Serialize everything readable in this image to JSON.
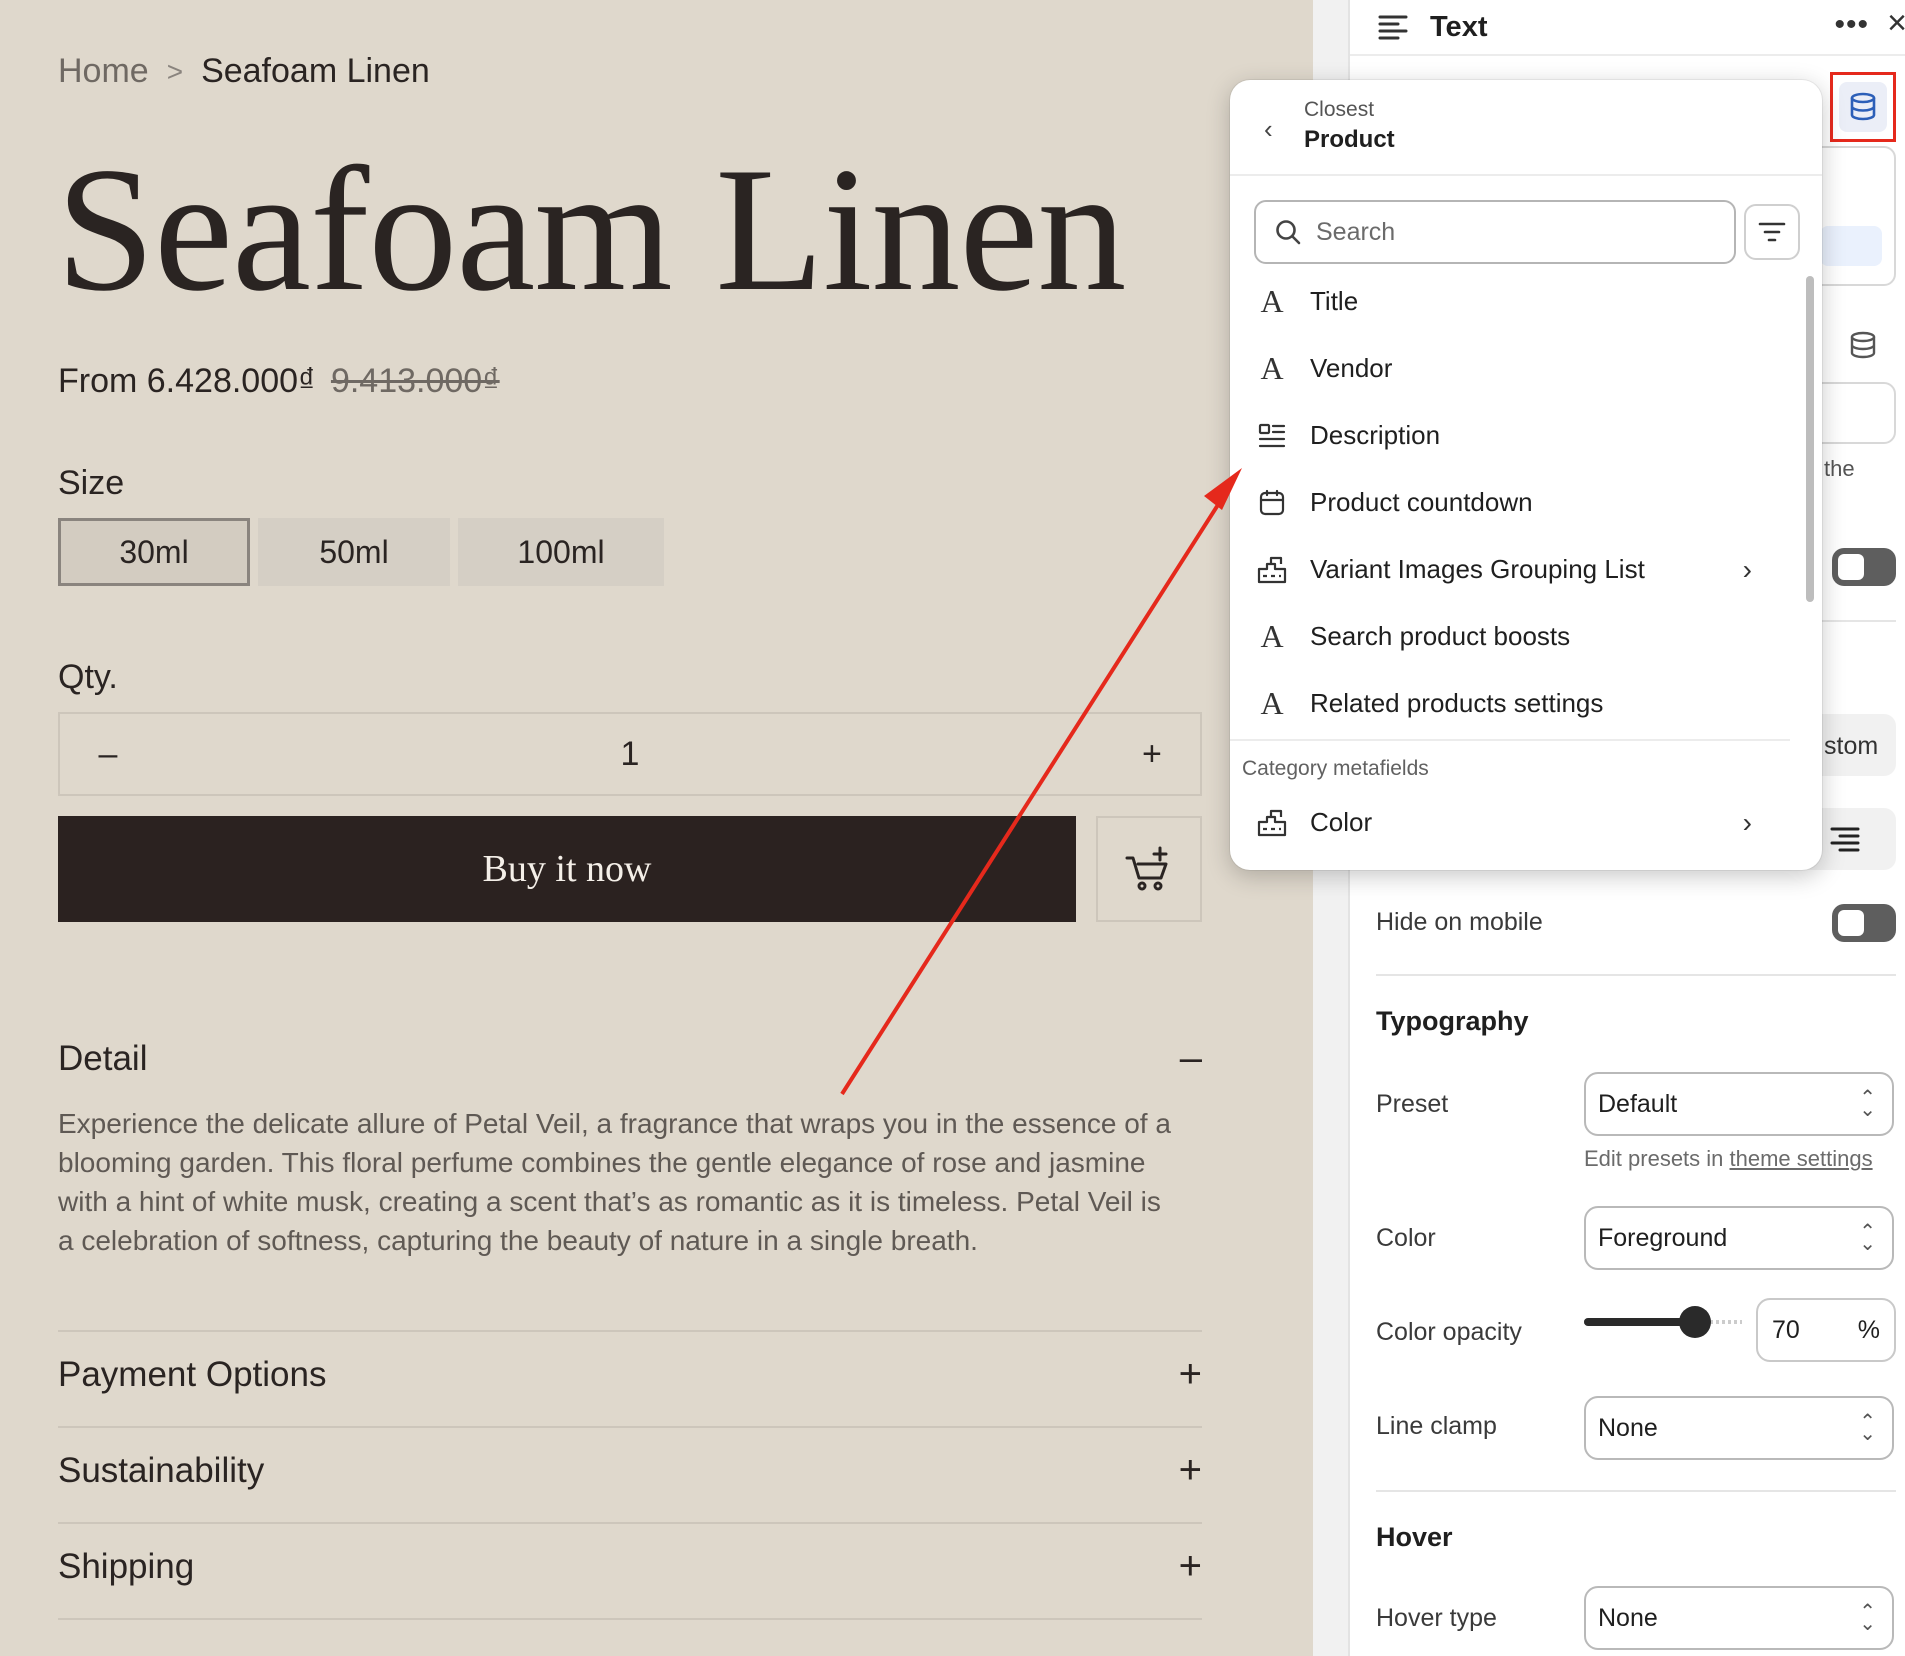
{
  "preview": {
    "breadcrumb": {
      "home": "Home",
      "separator": ">",
      "current": "Seafoam Linen"
    },
    "product_title": "Seafoam Linen",
    "price": {
      "prefix": "From 6.428.000₫",
      "compare": "9.413.000₫"
    },
    "size_label": "Size",
    "sizes": [
      "30ml",
      "50ml",
      "100ml"
    ],
    "selected_size": "30ml",
    "qty_label": "Qty.",
    "qty_value": "1",
    "qty_minus": "–",
    "qty_plus": "+",
    "buy_now": "Buy it now",
    "accordions": [
      {
        "title": "Detail",
        "sign": "–",
        "open": true
      },
      {
        "title": "Payment Options",
        "sign": "+"
      },
      {
        "title": "Sustainability",
        "sign": "+"
      },
      {
        "title": "Shipping",
        "sign": "+"
      }
    ],
    "detail_text": "Experience the delicate allure of Petal Veil, a fragrance that wraps you in the essence of a blooming garden. This floral perfume combines the gentle elegance of rose and jasmine with a hint of white musk, creating a scent that’s as romantic as it is timeless. Petal Veil is a celebration of softness, capturing the beauty of nature in a single breath."
  },
  "panel": {
    "title": "Text",
    "more_icon": "•••",
    "close_icon": "×",
    "partial_the": "the",
    "partial_custom": "stom",
    "hide_on_mobile": "Hide on mobile",
    "typography_title": "Typography",
    "preset_label": "Preset",
    "preset_value": "Default",
    "hint_prefix": "Edit presets in ",
    "hint_link": "theme settings",
    "color_label": "Color",
    "color_value": "Foreground",
    "opacity_label": "Color opacity",
    "opacity_value": "70",
    "opacity_unit": "%",
    "opacity_fraction": 0.7,
    "line_clamp_label": "Line clamp",
    "line_clamp_value": "None",
    "hover_title": "Hover",
    "hover_type_label": "Hover type",
    "hover_type_value": "None"
  },
  "popover": {
    "back_icon": "‹",
    "crumb_small": "Closest",
    "crumb_main": "Product",
    "search_placeholder": "Search",
    "items": [
      {
        "label": "Title",
        "icon": "A",
        "has_arrow": false
      },
      {
        "label": "Vendor",
        "icon": "A",
        "has_arrow": false
      },
      {
        "label": "Description",
        "icon": "description-icon",
        "has_arrow": false
      },
      {
        "label": "Product countdown",
        "icon": "calendar-icon",
        "has_arrow": false
      },
      {
        "label": "Variant Images Grouping List",
        "icon": "metaobject-icon",
        "has_arrow": true
      },
      {
        "label": "Search product boosts",
        "icon": "A",
        "has_arrow": false
      },
      {
        "label": "Related products settings",
        "icon": "A",
        "has_arrow": false
      }
    ],
    "group_label": "Category metafields",
    "group_items": [
      {
        "label": "Color",
        "icon": "metaobject-icon",
        "has_arrow": true
      }
    ],
    "arrow_glyph": "›"
  },
  "colors": {
    "preview_bg": "#dfd8cc",
    "buy_button": "#2b2220",
    "annotation_red": "#e5291c",
    "dynamic_source_blue": "#2c5fb8"
  }
}
